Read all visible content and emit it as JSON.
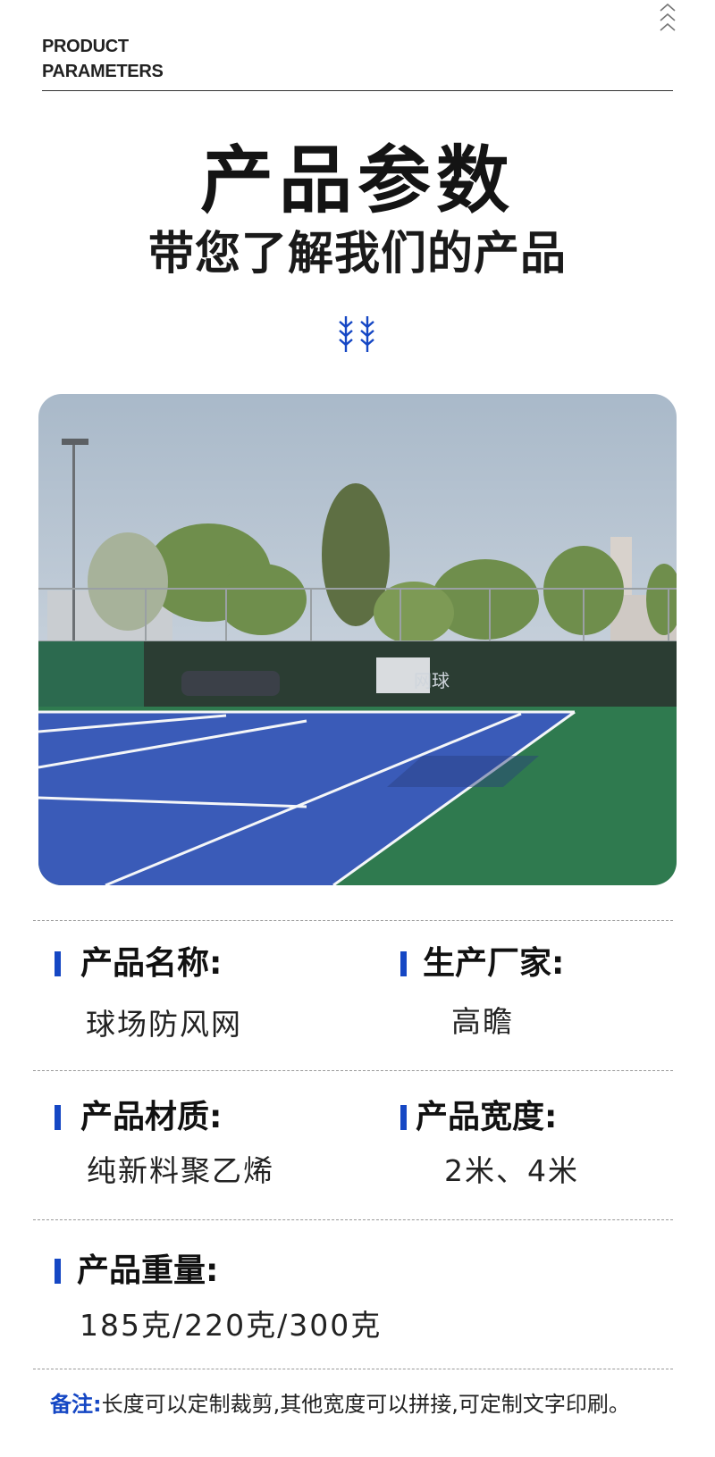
{
  "header": {
    "en_line1": "PRODUCT",
    "en_line2": "PARAMETERS",
    "icon": "triple-chevron-up-icon"
  },
  "title": {
    "main": "产品参数",
    "sub": "带您了解我们的产品",
    "decoration_icon": "double-chevron-down-icon"
  },
  "photo": {
    "subject": "tennis-court-windscreen-photo",
    "banner_text": "网球"
  },
  "colors": {
    "accent": "#1547c4",
    "court_blue": "#3a5bb8",
    "court_green": "#2f7a4f"
  },
  "params": [
    {
      "label": "产品名称:",
      "value": "球场防风网"
    },
    {
      "label": "生产厂家:",
      "value": "高瞻"
    },
    {
      "label": "产品材质:",
      "value": "纯新料聚乙烯"
    },
    {
      "label": "产品宽度:",
      "value": "2米、4米"
    },
    {
      "label": "产品重量:",
      "value": "185克/220克/300克"
    }
  ],
  "note": {
    "label": "备注:",
    "text": "长度可以定制裁剪,其他宽度可以拼接,可定制文字印刷。"
  }
}
